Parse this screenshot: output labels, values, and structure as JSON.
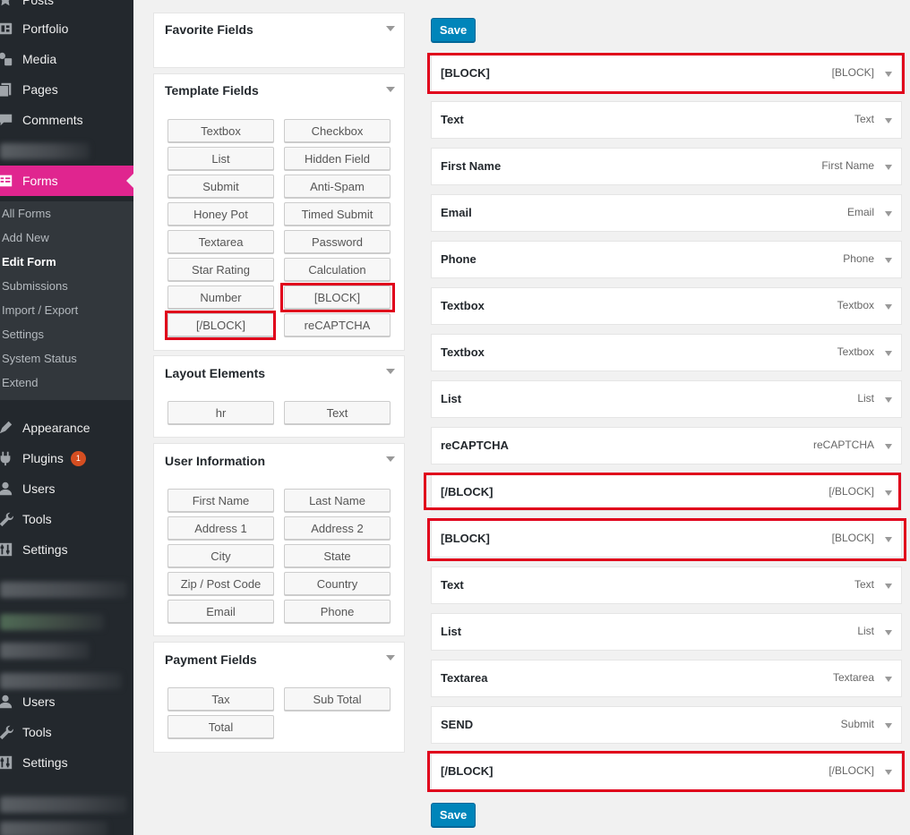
{
  "sidebar": {
    "top_items": [
      {
        "label": "Posts",
        "icon": "pin-icon"
      },
      {
        "label": "Portfolio",
        "icon": "portfolio-icon"
      },
      {
        "label": "Media",
        "icon": "media-icon"
      },
      {
        "label": "Pages",
        "icon": "pages-icon"
      },
      {
        "label": "Comments",
        "icon": "comments-icon"
      }
    ],
    "current": {
      "label": "Forms",
      "icon": "forms-icon"
    },
    "submenu": [
      "All Forms",
      "Add New",
      "Edit Form",
      "Submissions",
      "Import / Export",
      "Settings",
      "System Status",
      "Extend"
    ],
    "submenu_current": "Edit Form",
    "bottom_items": [
      {
        "label": "Appearance",
        "icon": "appearance-icon"
      },
      {
        "label": "Plugins",
        "icon": "plugins-icon",
        "badge": "1"
      },
      {
        "label": "Users",
        "icon": "users-icon"
      },
      {
        "label": "Tools",
        "icon": "tools-icon"
      },
      {
        "label": "Settings",
        "icon": "settings-icon"
      }
    ],
    "lower_items": [
      {
        "label": "Users",
        "icon": "users-icon"
      },
      {
        "label": "Tools",
        "icon": "tools-icon"
      },
      {
        "label": "Settings",
        "icon": "settings-icon"
      }
    ],
    "accent_color": "#e0258f"
  },
  "panels": {
    "favorite": {
      "title": "Favorite Fields"
    },
    "template": {
      "title": "Template Fields",
      "buttons": [
        "Textbox",
        "Checkbox",
        "List",
        "Hidden Field",
        "Submit",
        "Anti-Spam",
        "Honey Pot",
        "Timed Submit",
        "Textarea",
        "Password",
        "Star Rating",
        "Calculation",
        "Number",
        "[BLOCK]",
        "[/BLOCK]",
        "reCAPTCHA"
      ]
    },
    "layout": {
      "title": "Layout Elements",
      "buttons": [
        "hr",
        "Text"
      ]
    },
    "user": {
      "title": "User Information",
      "buttons": [
        "First Name",
        "Last Name",
        "Address 1",
        "Address 2",
        "City",
        "State",
        "Zip / Post Code",
        "Country",
        "Email",
        "Phone"
      ]
    },
    "payment": {
      "title": "Payment Fields",
      "buttons": [
        "Tax",
        "Sub Total",
        "Total"
      ]
    }
  },
  "form": {
    "save_label": "Save",
    "fields": [
      {
        "label": "[BLOCK]",
        "type": "[BLOCK]"
      },
      {
        "label": "Text",
        "type": "Text"
      },
      {
        "label": "First Name",
        "type": "First Name"
      },
      {
        "label": "Email",
        "type": "Email"
      },
      {
        "label": "Phone",
        "type": "Phone"
      },
      {
        "label": "Textbox",
        "type": "Textbox"
      },
      {
        "label": "Textbox",
        "type": "Textbox"
      },
      {
        "label": "List",
        "type": "List"
      },
      {
        "label": "reCAPTCHA",
        "type": "reCAPTCHA"
      },
      {
        "label": "[/BLOCK]",
        "type": "[/BLOCK]"
      },
      {
        "label": "[BLOCK]",
        "type": "[BLOCK]"
      },
      {
        "label": "Text",
        "type": "Text"
      },
      {
        "label": "List",
        "type": "List"
      },
      {
        "label": "Textarea",
        "type": "Textarea"
      },
      {
        "label": "SEND",
        "type": "Submit"
      },
      {
        "label": "[/BLOCK]",
        "type": "[/BLOCK]"
      }
    ]
  },
  "colors": {
    "save_button": "#0085ba",
    "highlight": "#e0001b"
  }
}
